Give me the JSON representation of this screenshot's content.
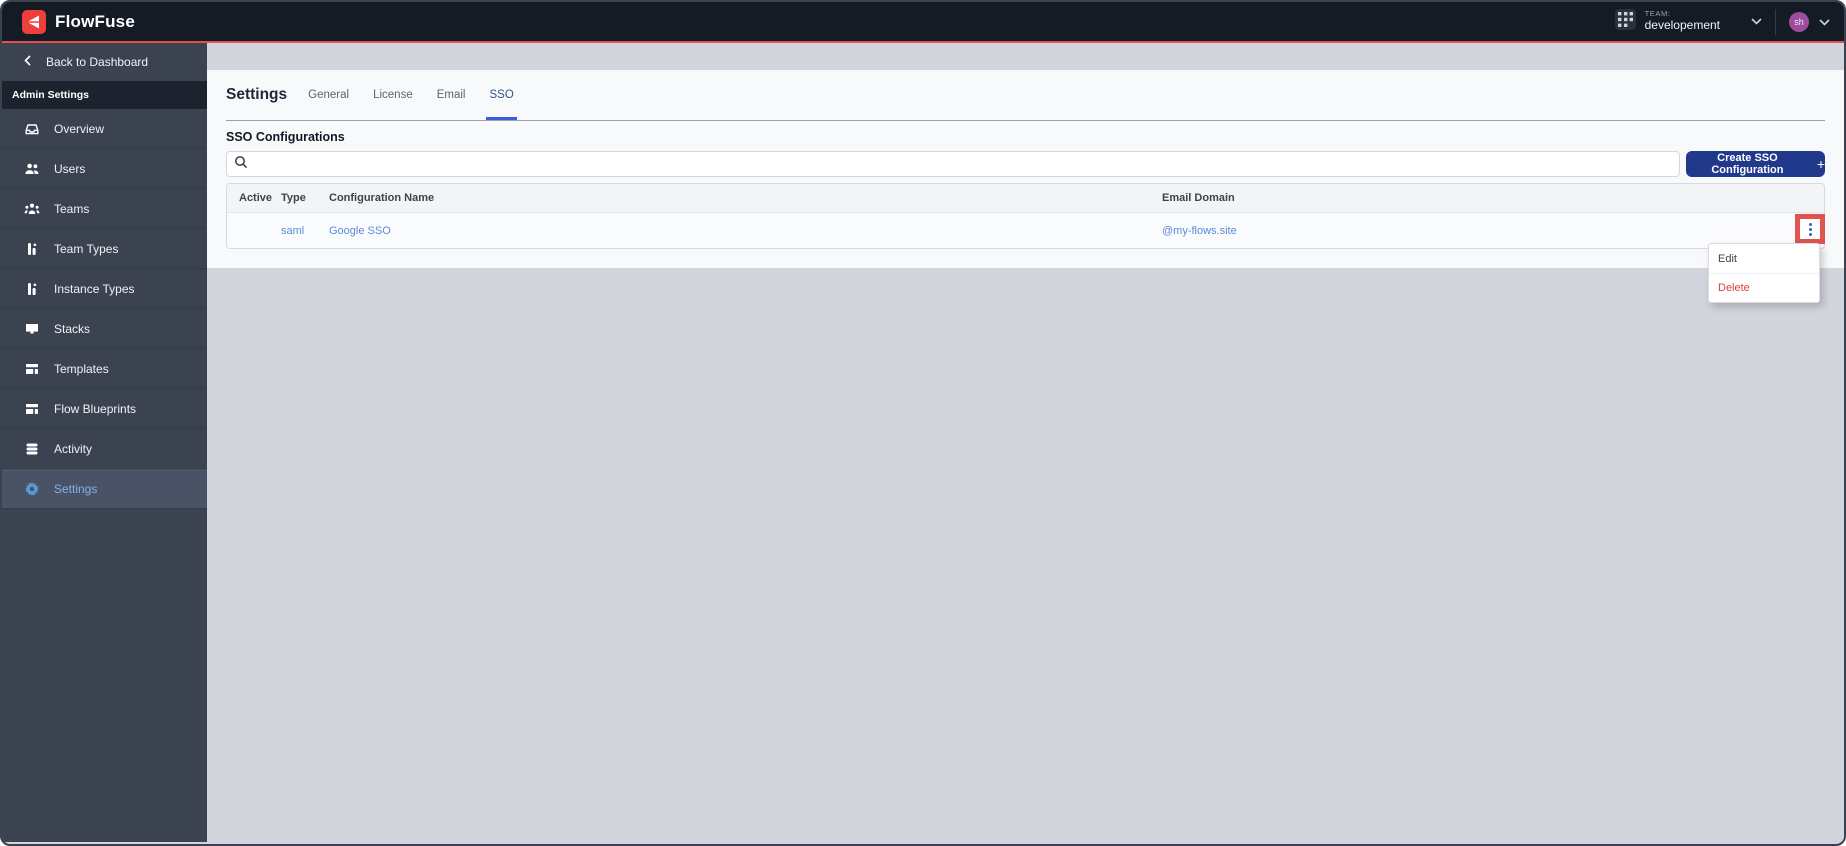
{
  "topbar": {
    "brand": "FlowFuse",
    "team_label": "TEAM:",
    "team_name": "developement",
    "avatar_initials": "sh"
  },
  "sidebar": {
    "back_label": "Back to Dashboard",
    "section_label": "Admin Settings",
    "items": [
      {
        "label": "Overview"
      },
      {
        "label": "Users"
      },
      {
        "label": "Teams"
      },
      {
        "label": "Team Types"
      },
      {
        "label": "Instance Types"
      },
      {
        "label": "Stacks"
      },
      {
        "label": "Templates"
      },
      {
        "label": "Flow Blueprints"
      },
      {
        "label": "Activity"
      },
      {
        "label": "Settings"
      }
    ]
  },
  "main": {
    "title": "Settings",
    "tabs": [
      {
        "label": "General"
      },
      {
        "label": "License"
      },
      {
        "label": "Email"
      },
      {
        "label": "SSO"
      }
    ],
    "section_title": "SSO Configurations",
    "search": {
      "value": "",
      "placeholder": ""
    },
    "create_button": "Create SSO Configuration",
    "create_button_plus": "+",
    "table": {
      "columns": [
        "Active",
        "Type",
        "Configuration Name",
        "Email Domain"
      ],
      "rows": [
        {
          "active": "",
          "type": "saml",
          "name": "Google SSO",
          "email_domain": "@my-flows.site"
        }
      ]
    },
    "row_menu": {
      "items": [
        {
          "label": "Edit"
        },
        {
          "label": "Delete"
        }
      ]
    }
  },
  "colors": {
    "brand_red": "#ee3f3c",
    "header_line_red": "#e2514c",
    "sidebar_bg": "#3b4351",
    "active_nav_bg": "#4a5366",
    "active_nav_text": "#80b2e6",
    "primary_button": "#21398b",
    "link_blue": "#5b8bd8",
    "tab_underline": "#3e5ed9",
    "danger_red": "#e0403a",
    "annotation_red": "#e0534e"
  }
}
